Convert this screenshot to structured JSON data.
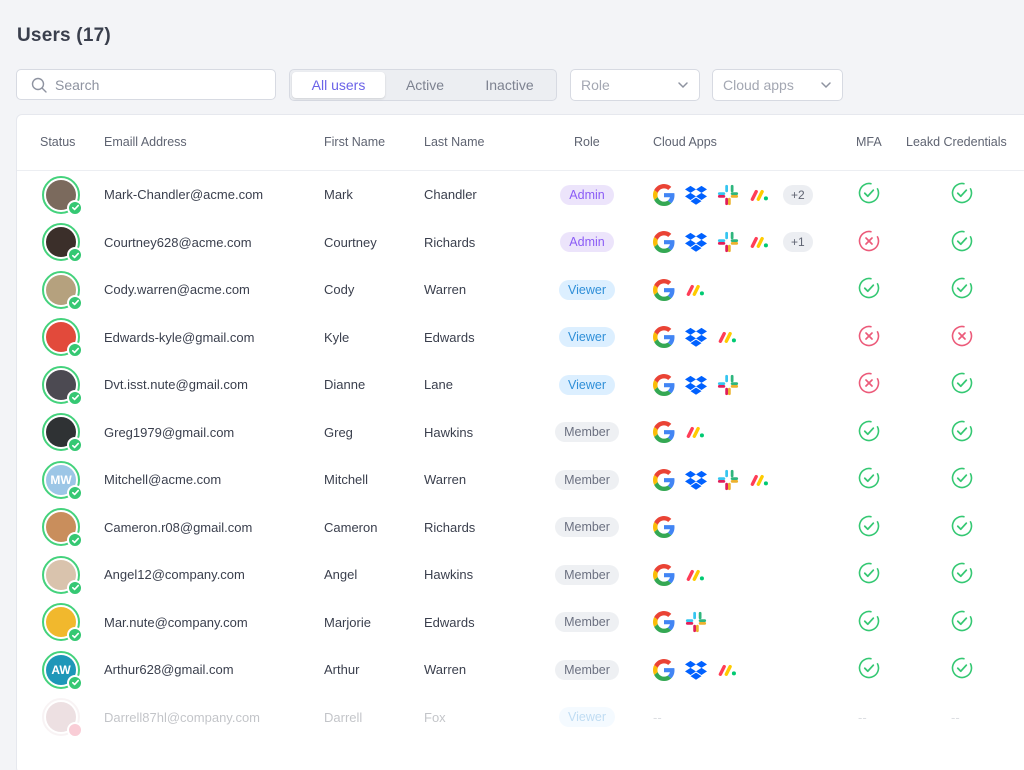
{
  "page": {
    "title": "Users (17)"
  },
  "search": {
    "placeholder": "Search"
  },
  "filter_tabs": [
    {
      "label": "All users",
      "active": true
    },
    {
      "label": "Active",
      "active": false
    },
    {
      "label": "Inactive",
      "active": false
    }
  ],
  "dropdowns": {
    "role": "Role",
    "cloud_apps": "Cloud apps"
  },
  "columns": {
    "status": "Status",
    "email": "Emaill Address",
    "first_name": "First Name",
    "last_name": "Last Name",
    "role": "Role",
    "cloud_apps": "Cloud Apps",
    "mfa": "MFA",
    "leaked": "Leakd Credentials"
  },
  "colors": {
    "accent": "#6b63e8",
    "success": "#35c873",
    "danger": "#ec5b7a",
    "admin_bg": "#ece4fb",
    "admin_fg": "#8b5cf6",
    "viewer_bg": "#dcefff",
    "viewer_fg": "#2f8fd8",
    "member_bg": "#eef0f3",
    "member_fg": "#6b7080"
  },
  "users": [
    {
      "email": "Mark-Chandler@acme.com",
      "first": "Mark",
      "last": "Chandler",
      "role": "Admin",
      "apps": [
        "google",
        "dropbox",
        "slack",
        "monday"
      ],
      "more": "+2",
      "mfa": "ok",
      "leaked": "ok",
      "avatar_color": "#7b6a5d",
      "initials": ""
    },
    {
      "email": "Courtney628@acme.com",
      "first": "Courtney",
      "last": "Richards",
      "role": "Admin",
      "apps": [
        "google",
        "dropbox",
        "slack",
        "monday"
      ],
      "more": "+1",
      "mfa": "fail",
      "leaked": "ok",
      "avatar_color": "#3b2f2a",
      "initials": ""
    },
    {
      "email": "Cody.warren@acme.com",
      "first": "Cody",
      "last": "Warren",
      "role": "Viewer",
      "apps": [
        "google",
        "monday"
      ],
      "more": "",
      "mfa": "ok",
      "leaked": "ok",
      "avatar_color": "#b5a17e",
      "initials": ""
    },
    {
      "email": "Edwards-kyle@gmail.com",
      "first": "Kyle",
      "last": "Edwards",
      "role": "Viewer",
      "apps": [
        "google",
        "dropbox",
        "monday"
      ],
      "more": "",
      "mfa": "fail",
      "leaked": "fail",
      "avatar_color": "#e24a3b",
      "initials": ""
    },
    {
      "email": "Dvt.isst.nute@gmail.com",
      "first": "Dianne",
      "last": "Lane",
      "role": "Viewer",
      "apps": [
        "google",
        "dropbox",
        "slack"
      ],
      "more": "",
      "mfa": "fail",
      "leaked": "ok",
      "avatar_color": "#4c4a52",
      "initials": ""
    },
    {
      "email": "Greg1979@gmail.com",
      "first": "Greg",
      "last": "Hawkins",
      "role": "Member",
      "apps": [
        "google",
        "monday"
      ],
      "more": "",
      "mfa": "ok",
      "leaked": "ok",
      "avatar_color": "#2f3234",
      "initials": ""
    },
    {
      "email": "Mitchell@acme.com",
      "first": "Mitchell",
      "last": "Warren",
      "role": "Member",
      "apps": [
        "google",
        "dropbox",
        "slack",
        "monday"
      ],
      "more": "",
      "mfa": "ok",
      "leaked": "ok",
      "avatar_color": "#9cc6e6",
      "initials": "MW"
    },
    {
      "email": "Cameron.r08@gmail.com",
      "first": "Cameron",
      "last": "Richards",
      "role": "Member",
      "apps": [
        "google"
      ],
      "more": "",
      "mfa": "ok",
      "leaked": "ok",
      "avatar_color": "#c98e5c",
      "initials": ""
    },
    {
      "email": "Angel12@company.com",
      "first": "Angel",
      "last": "Hawkins",
      "role": "Member",
      "apps": [
        "google",
        "monday"
      ],
      "more": "",
      "mfa": "ok",
      "leaked": "ok",
      "avatar_color": "#d9c3ad",
      "initials": ""
    },
    {
      "email": "Mar.nute@company.com",
      "first": "Marjorie",
      "last": "Edwards",
      "role": "Member",
      "apps": [
        "google",
        "slack"
      ],
      "more": "",
      "mfa": "ok",
      "leaked": "ok",
      "avatar_color": "#f1b82d",
      "initials": ""
    },
    {
      "email": "Arthur628@gmail.com",
      "first": "Arthur",
      "last": "Warren",
      "role": "Member",
      "apps": [
        "google",
        "dropbox",
        "monday"
      ],
      "more": "",
      "mfa": "ok",
      "leaked": "ok",
      "avatar_color": "#1e97b8",
      "initials": "AW"
    },
    {
      "email": "Darrell87hl@company.com",
      "first": "Darrell",
      "last": "Fox",
      "role": "Viewer",
      "apps": [],
      "more": "--",
      "mfa": "--",
      "leaked": "--",
      "avatar_color": "#c49aa1",
      "initials": "",
      "faded": true
    }
  ]
}
